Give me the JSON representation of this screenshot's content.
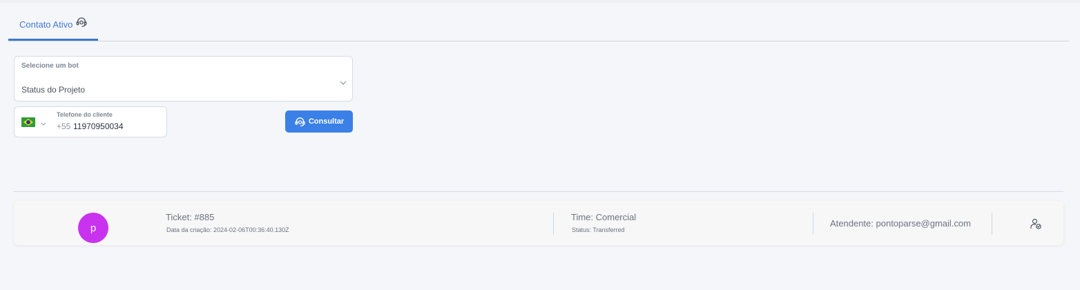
{
  "tabs": [
    {
      "label": "Contato Ativo",
      "icon": "headset-icon",
      "active": true
    }
  ],
  "form": {
    "bot_select": {
      "label": "Selecione um bot",
      "value": "Status do Projeto"
    },
    "phone": {
      "label": "Telefone do cliente",
      "country_icon": "brazil-flag-icon",
      "country_code": "+55",
      "value": "11970950034"
    },
    "consult_button": {
      "label": "Consultar",
      "icon": "headset-icon"
    }
  },
  "ticket": {
    "avatar_letter": "p",
    "number": "Ticket: #885",
    "created": "Data da criação: 2024-02-06T00:36:40.130Z",
    "team": "Time: Comercial",
    "status": "Status: Transferred",
    "agent": "Atendente: pontoparse@gmail.com",
    "action_icon": "user-check-icon"
  },
  "colors": {
    "accent": "#3b80e6",
    "tab_active": "#3e7ad1",
    "avatar": "#c932ee",
    "background": "#f5f6f9"
  }
}
